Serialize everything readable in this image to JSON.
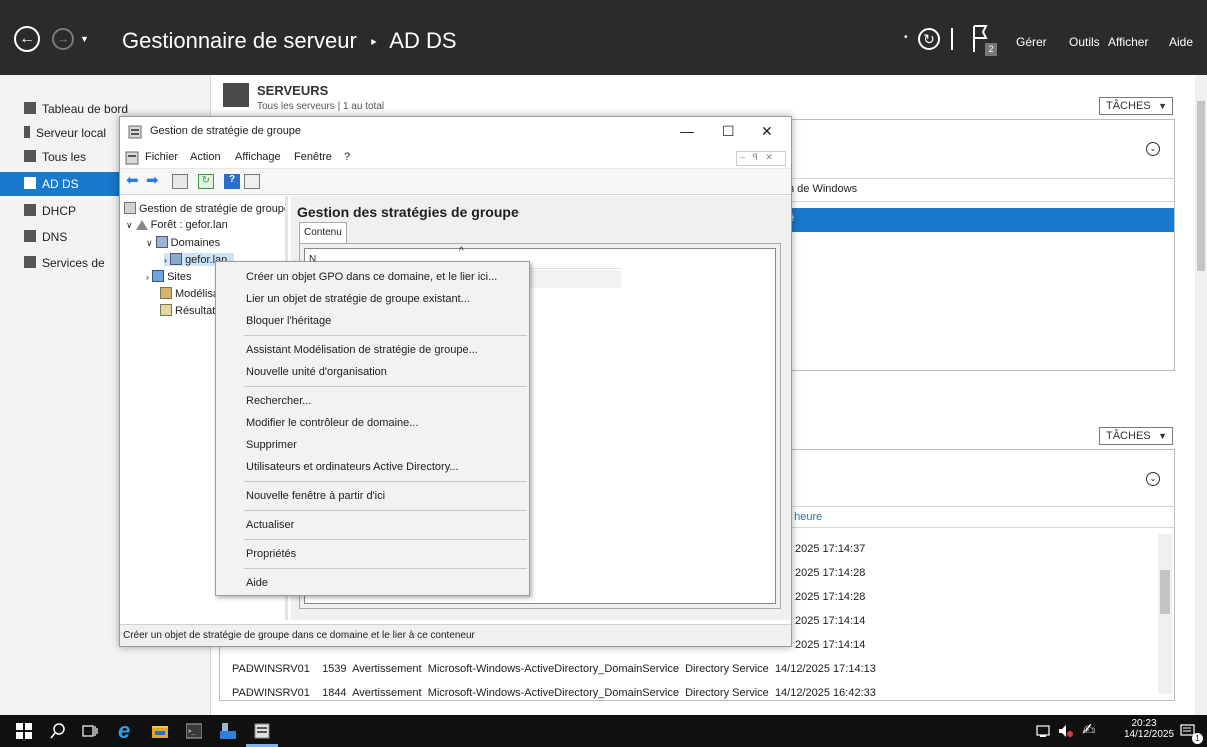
{
  "app": {
    "title": "Gestionnaire de serveur",
    "breadcrumb_sep": "‣",
    "section": "AD DS",
    "menus": [
      "Gérer",
      "Outils",
      "Afficher",
      "Aide"
    ],
    "notification_count": "2"
  },
  "leftnav": {
    "items": [
      {
        "label": "Tableau de bord",
        "icon": "dashboard-icon"
      },
      {
        "label": "Serveur local",
        "icon": "server-icon"
      },
      {
        "label": "Tous les serveurs",
        "icon": "servers-icon"
      },
      {
        "label": "AD DS",
        "icon": "adds-icon"
      },
      {
        "label": "DHCP",
        "icon": "dhcp-icon"
      },
      {
        "label": "DNS",
        "icon": "dns-icon"
      },
      {
        "label": "Services de fichiers et de stockage",
        "icon": "storage-icon"
      }
    ]
  },
  "servers": {
    "title": "SERVEURS",
    "subtitle": "Tous les serveurs | 1 au total",
    "taches": "TÂCHES",
    "col_fragment": "n de Windows",
    "row_fragment": "é"
  },
  "events": {
    "taches": "TÂCHES",
    "col_fragment": "t heure",
    "time_fragments": [
      "2025 17:14:37",
      "2025 17:14:28",
      "2025 17:14:28",
      "2025 17:14:14",
      "2025 17:14:14"
    ],
    "rows": [
      {
        "server": "PADWINSRV01",
        "id": "1539",
        "level": "Avertissement",
        "source": "Microsoft-Windows-ActiveDirectory_DomainService",
        "log": "Directory Service",
        "datetime": "14/12/2025 17:14:13"
      },
      {
        "server": "PADWINSRV01",
        "id": "1844",
        "level": "Avertissement",
        "source": "Microsoft-Windows-ActiveDirectory_DomainService",
        "log": "Directory Service",
        "datetime": "14/12/2025 16:42:33"
      }
    ]
  },
  "gpmc": {
    "title": "Gestion de stratégie de groupe",
    "menu": [
      "Fichier",
      "Action",
      "Affichage",
      "Fenêtre",
      "?"
    ],
    "tree": {
      "root": "Gestion de stratégie de groupe",
      "forest": "Forêt : gefor.lan",
      "domains": "Domaines",
      "domain": "gefor.lan",
      "sites": "Sites",
      "modeling": "Modélisation de stratégie de groupe",
      "results": "Résultats de stratégie de groupe"
    },
    "right_title": "Gestion des stratégies de groupe",
    "tab": "Contenu",
    "col_fragment": "N",
    "status": "Créer un objet de stratégie de groupe dans ce domaine et le lier à ce conteneur"
  },
  "context_menu": {
    "items": [
      "Créer un objet GPO dans ce domaine, et le lier ici...",
      "Lier un objet de stratégie de groupe existant...",
      "Bloquer l'héritage",
      "Assistant Modélisation de stratégie de groupe...",
      "Nouvelle unité d'organisation",
      "Rechercher...",
      "Modifier le contrôleur de domaine...",
      "Supprimer",
      "Utilisateurs et ordinateurs Active Directory...",
      "Nouvelle fenêtre à partir d'ici",
      "Actualiser",
      "Propriétés",
      "Aide"
    ]
  },
  "taskbar": {
    "time": "20:23",
    "date": "14/12/2025",
    "notif_badge": "1"
  },
  "colors": {
    "accent": "#1979ca",
    "titlebar": "#2b2b2b",
    "taskbar": "#101010"
  }
}
